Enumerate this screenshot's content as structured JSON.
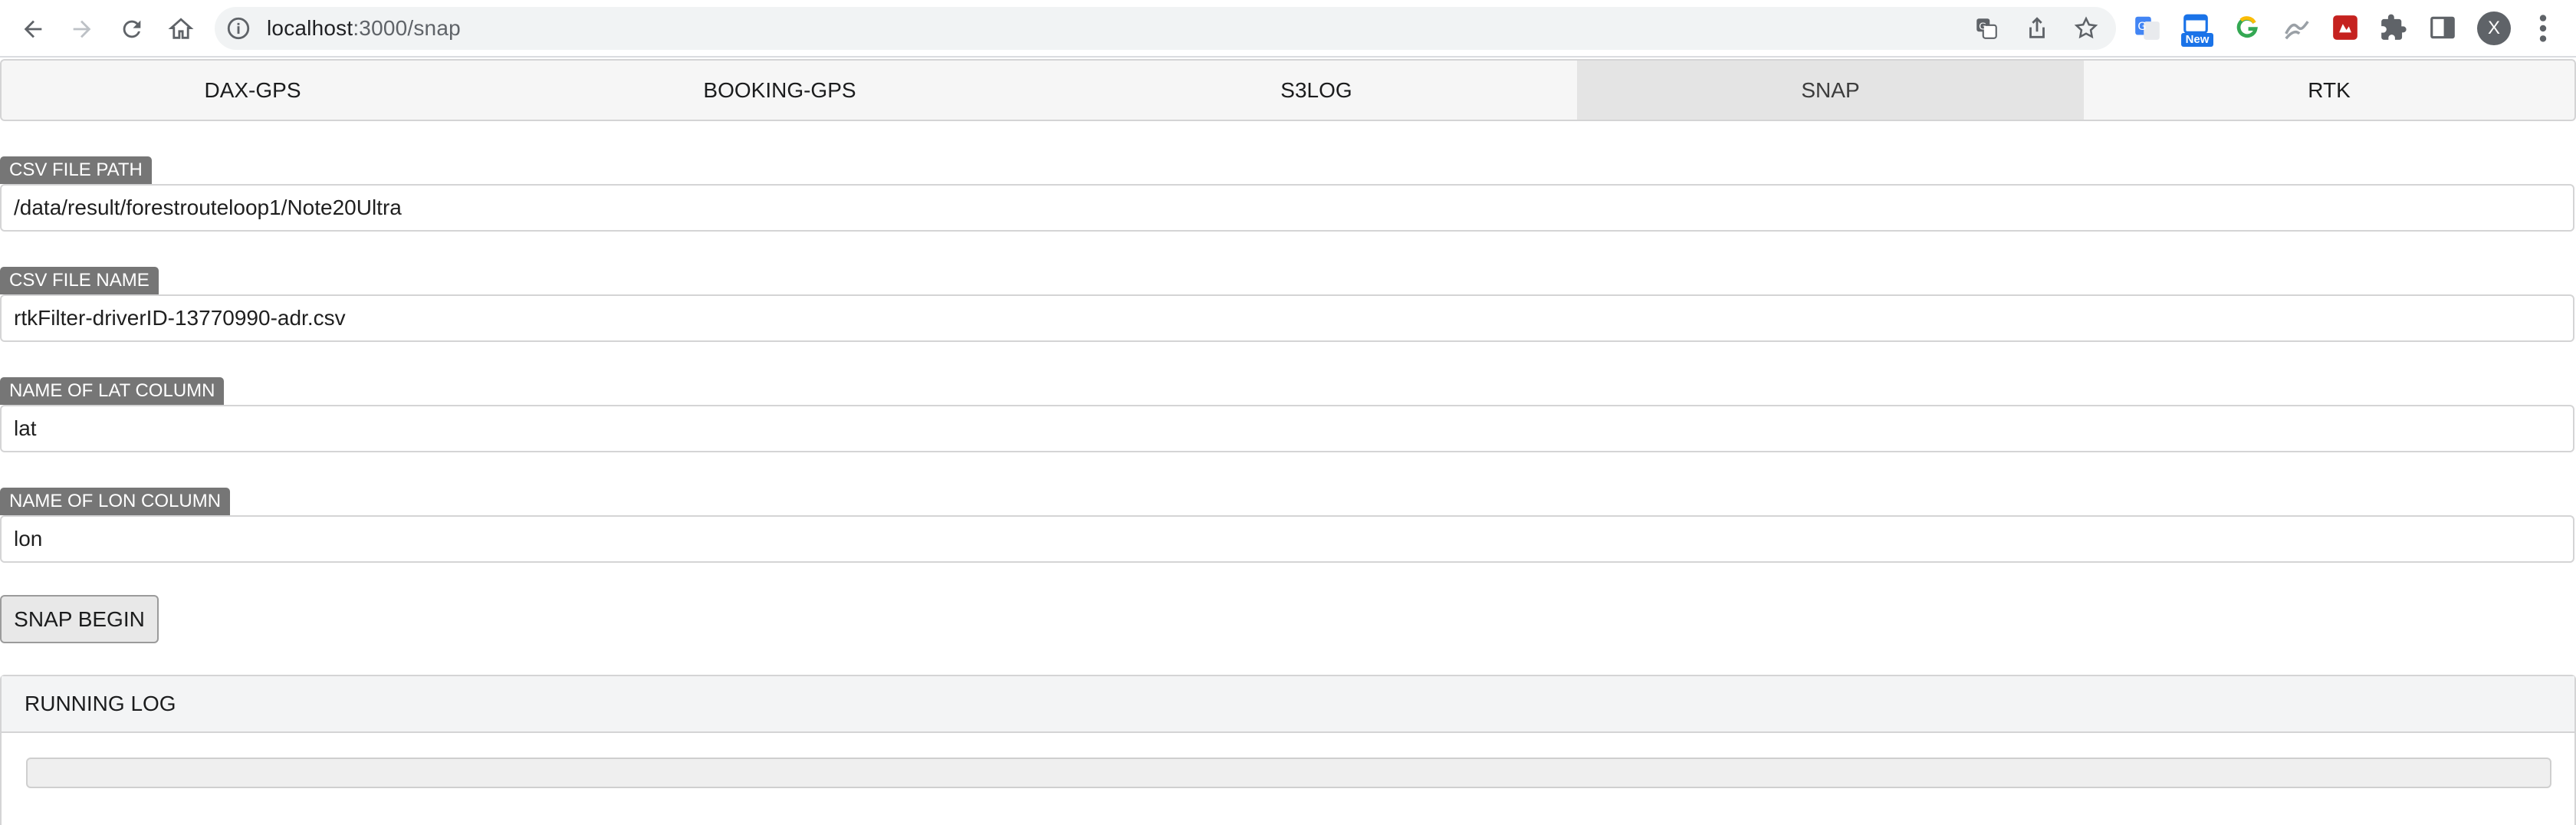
{
  "browser": {
    "url_host": "localhost",
    "url_path": ":3000/snap",
    "extension_new_badge": "New",
    "profile_initial": "X"
  },
  "tabs": [
    {
      "label": "DAX-GPS",
      "active": false
    },
    {
      "label": "BOOKING-GPS",
      "active": false
    },
    {
      "label": "S3LOG",
      "active": false
    },
    {
      "label": "SNAP",
      "active": true
    },
    {
      "label": "RTK",
      "active": false
    }
  ],
  "form": {
    "csv_path": {
      "label": "CSV FILE PATH",
      "value": "/data/result/forestrouteloop1/Note20Ultra"
    },
    "csv_name": {
      "label": "CSV FILE NAME",
      "value": "rtkFilter-driverID-13770990-adr.csv"
    },
    "lat_column": {
      "label": "NAME OF LAT COLUMN",
      "value": "lat"
    },
    "lon_column": {
      "label": "NAME OF LON COLUMN",
      "value": "lon"
    },
    "submit_label": "SNAP BEGIN"
  },
  "log": {
    "title": "RUNNING LOG",
    "progress": 0
  }
}
